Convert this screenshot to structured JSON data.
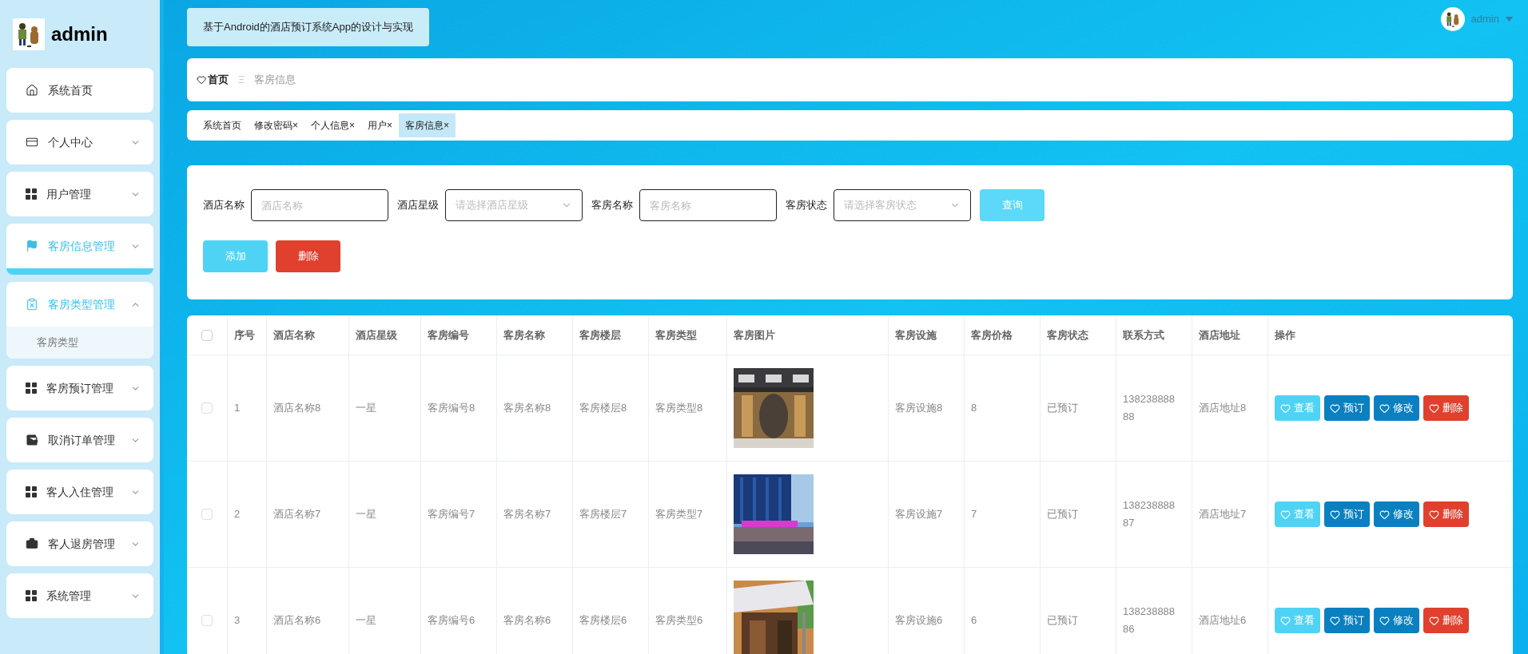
{
  "sidebar": {
    "brand": "admin",
    "items": [
      {
        "label": "系统首页",
        "selected": false,
        "expanded": false
      },
      {
        "label": "个人中心",
        "selected": false,
        "expanded": false
      },
      {
        "label": "用户管理",
        "selected": false,
        "expanded": false
      },
      {
        "label": "客房信息管理",
        "selected": true,
        "expanded": false
      },
      {
        "label": "客房类型管理",
        "selected": false,
        "expanded": true,
        "children": [
          {
            "label": "客房类型"
          }
        ]
      },
      {
        "label": "客房预订管理",
        "selected": false,
        "expanded": false
      },
      {
        "label": "取消订单管理",
        "selected": false,
        "expanded": false
      },
      {
        "label": "客人入住管理",
        "selected": false,
        "expanded": false
      },
      {
        "label": "客人退房管理",
        "selected": false,
        "expanded": false
      },
      {
        "label": "系统管理",
        "selected": false,
        "expanded": false
      }
    ]
  },
  "header": {
    "title": "基于Android的酒店预订系统App的设计与实现",
    "user": "admin"
  },
  "breadcrumb": {
    "home": "首页",
    "separator": "Ξ",
    "current": "客房信息"
  },
  "tabs": [
    {
      "label": "系统首页",
      "closable": false,
      "selected": false
    },
    {
      "label": "修改密码",
      "closable": true,
      "selected": false
    },
    {
      "label": "个人信息",
      "closable": true,
      "selected": false
    },
    {
      "label": "用户",
      "closable": true,
      "selected": false
    },
    {
      "label": "客房信息",
      "closable": true,
      "selected": true
    }
  ],
  "tab_close_mark": "×",
  "filters": [
    {
      "label": "酒店名称",
      "placeholder": "酒店名称",
      "kind": "input"
    },
    {
      "label": "酒店星级",
      "placeholder": "请选择酒店星级",
      "kind": "select"
    },
    {
      "label": "客房名称",
      "placeholder": "客房名称",
      "kind": "input"
    },
    {
      "label": "客房状态",
      "placeholder": "请选择客房状态",
      "kind": "select"
    }
  ],
  "search_button": "查询",
  "actions": [
    {
      "label": "添加",
      "kind": "add"
    },
    {
      "label": "删除",
      "kind": "delete"
    }
  ],
  "table": {
    "all_checked": false,
    "columns": [
      "序号",
      "酒店名称",
      "酒店星级",
      "客房编号",
      "客房名称",
      "客房楼层",
      "客房类型",
      "客房图片",
      "客房设施",
      "客房价格",
      "客房状态",
      "联系方式",
      "酒店地址",
      "操作"
    ],
    "rows": [
      {
        "checked": false,
        "cells": [
          "1",
          "酒店名称8",
          "一星",
          "客房编号8",
          "客房名称8",
          "客房楼层8",
          "客房类型8",
          "",
          "客房设施8",
          "8",
          "已预订",
          "13823888888",
          "酒店地址8"
        ],
        "actions": [
          {
            "label": "查看",
            "kind": "view"
          },
          {
            "label": "预订",
            "kind": "book"
          },
          {
            "label": "修改",
            "kind": "edit"
          },
          {
            "label": "删除",
            "kind": "delete"
          }
        ]
      },
      {
        "checked": false,
        "cells": [
          "2",
          "酒店名称7",
          "一星",
          "客房编号7",
          "客房名称7",
          "客房楼层7",
          "客房类型7",
          "",
          "客房设施7",
          "7",
          "已预订",
          "13823888887",
          "酒店地址7"
        ],
        "actions": [
          {
            "label": "查看",
            "kind": "view"
          },
          {
            "label": "预订",
            "kind": "book"
          },
          {
            "label": "修改",
            "kind": "edit"
          },
          {
            "label": "删除",
            "kind": "delete"
          }
        ]
      },
      {
        "checked": false,
        "cells": [
          "3",
          "酒店名称6",
          "一星",
          "客房编号6",
          "客房名称6",
          "客房楼层6",
          "客房类型6",
          "",
          "客房设施6",
          "6",
          "已预订",
          "13823888886",
          "酒店地址6"
        ],
        "actions": [
          {
            "label": "查看",
            "kind": "view"
          },
          {
            "label": "预订",
            "kind": "book"
          },
          {
            "label": "修改",
            "kind": "edit"
          },
          {
            "label": "删除",
            "kind": "delete"
          }
        ]
      }
    ]
  }
}
